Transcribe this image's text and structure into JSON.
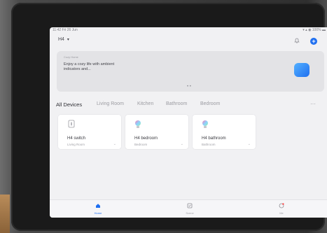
{
  "statusbar": {
    "time": "11:42  Fri 26  Jun",
    "icons": "▾ ▴ ◉ 100% ▬"
  },
  "header": {
    "home_title": "H4",
    "home_chevron": "▾",
    "icons": [
      "bell-icon",
      "plus-icon"
    ],
    "accent": "#1f6ff0"
  },
  "banner": {
    "kicker": "Cozy Home",
    "text": "Enjoy a cozy life with ambient indicators and...",
    "pager": "• •"
  },
  "tabs": [
    {
      "label": "All Devices",
      "active": true
    },
    {
      "label": "Living Room",
      "active": false
    },
    {
      "label": "Kitchen",
      "active": false
    },
    {
      "label": "Bathroom",
      "active": false
    },
    {
      "label": "Bedroom",
      "active": false
    }
  ],
  "tabs_more": "···",
  "devices": [
    {
      "name": "H4 switch",
      "room": "Living Room",
      "icon": "switch-icon",
      "dropdown": "⌄"
    },
    {
      "name": "H4 bedroom",
      "room": "Bedroom",
      "icon": "bulb-icon",
      "dropdown": "⌄"
    },
    {
      "name": "H4 bathroom",
      "room": "Bathroom",
      "icon": "bulb-icon",
      "dropdown": "⌄"
    }
  ],
  "bottom_nav": [
    {
      "label": "Home",
      "icon": "home-icon",
      "active": true
    },
    {
      "label": "Scene",
      "icon": "scene-icon",
      "active": false
    },
    {
      "label": "Me",
      "icon": "profile-icon",
      "active": false
    }
  ]
}
